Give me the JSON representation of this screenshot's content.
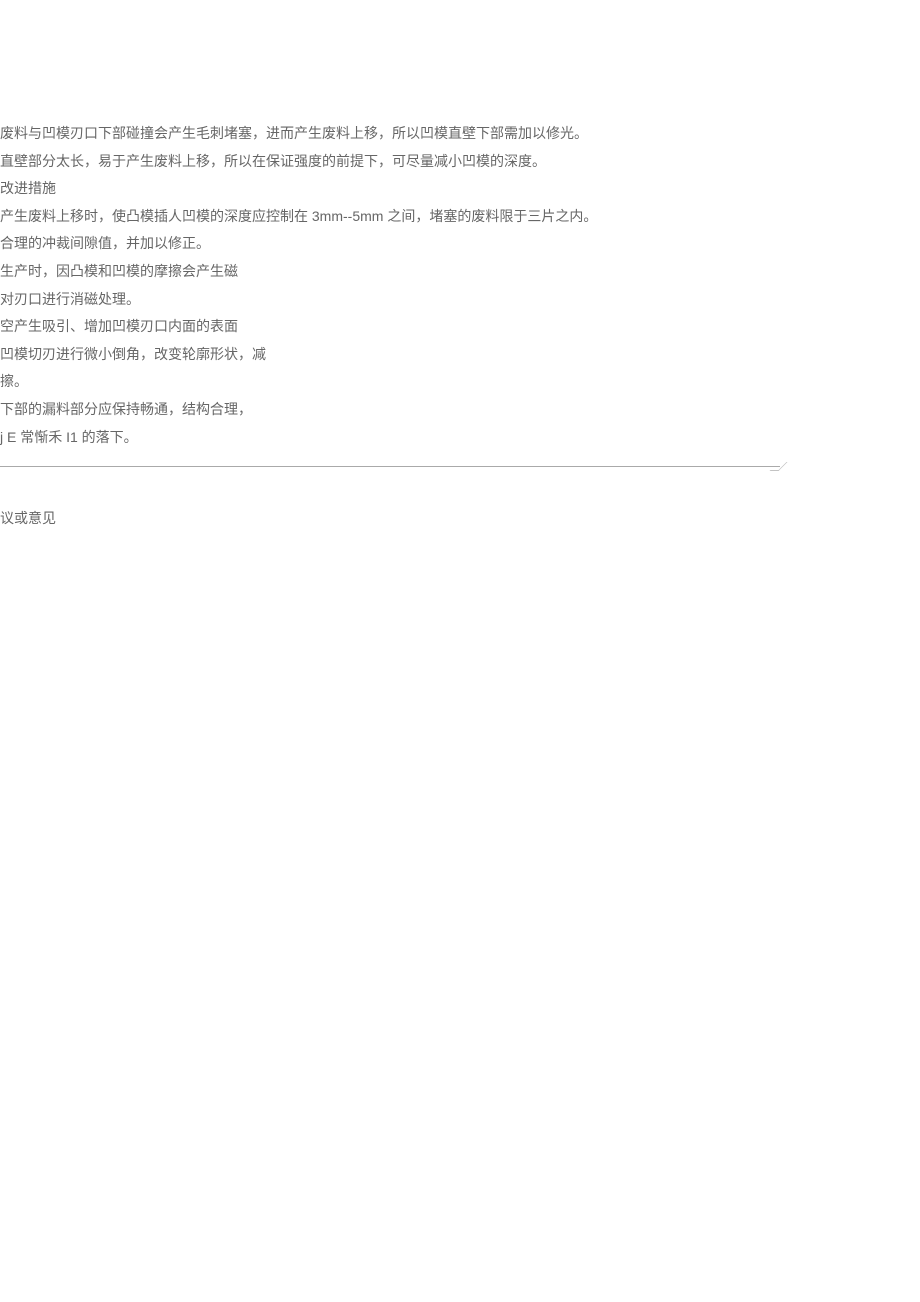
{
  "lines": [
    "废料与凹模刃口下部碰撞会产生毛刺堵塞，进而产生废料上移，所以凹模直壁下部需加以修光。",
    "直壁部分太长，易于产生废料上移，所以在保证强度的前提下，可尽量减小凹模的深度。",
    "改进措施",
    "产生废料上移时，使凸模插人凹模的深度应控制在 3mm--5mm 之间，堵塞的废料限于三片之内。",
    "合理的冲裁间隙值，并加以修正。",
    "生产时，因凸模和凹模的摩擦会产生磁",
    "对刃口进行消磁处理。",
    "空产生吸引、增加凹模刃口内面的表面",
    "凹模切刃进行微小倒角，改变轮廓形状，减",
    "擦。",
    "下部的漏料部分应保持畅通，结构合理，",
    "j E 常惭禾 I1 的落下。"
  ],
  "heading": "议或意见"
}
